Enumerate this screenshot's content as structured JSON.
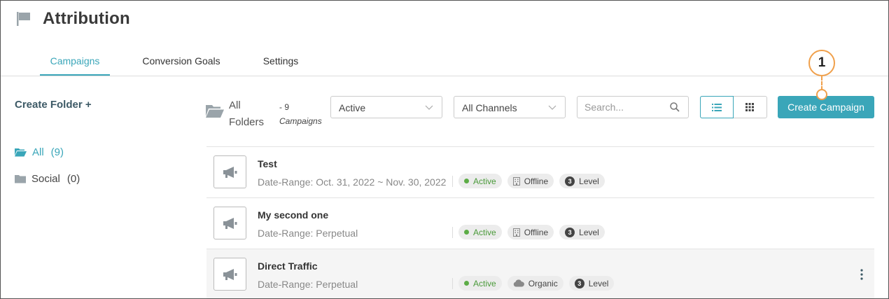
{
  "header": {
    "title": "Attribution",
    "icon": "flag-icon"
  },
  "tabs": [
    {
      "label": "Campaigns",
      "active": true
    },
    {
      "label": "Conversion Goals",
      "active": false
    },
    {
      "label": "Settings",
      "active": false
    }
  ],
  "sidebar": {
    "create_folder": "Create Folder +",
    "folders": [
      {
        "name": "All",
        "count": "(9)",
        "active": true
      },
      {
        "name": "Social",
        "count": "(0)",
        "active": false
      }
    ]
  },
  "toolbar": {
    "folder_label": "All Folders",
    "count_text": "- 9",
    "count_label": "Campaigns",
    "status_select": "Active",
    "channel_select": "All Channels",
    "search_placeholder": "Search...",
    "view_mode": "list",
    "create_button": "Create Campaign"
  },
  "callout": {
    "number": "1"
  },
  "campaigns": [
    {
      "name": "Test",
      "date": "Date-Range: Oct. 31, 2022 ~ Nov. 30, 2022",
      "status": "Active",
      "channel": "Offline",
      "channel_icon": "building-icon",
      "level_num": "3",
      "level_label": "Level"
    },
    {
      "name": "My second one",
      "date": "Date-Range: Perpetual",
      "status": "Active",
      "channel": "Offline",
      "channel_icon": "building-icon",
      "level_num": "3",
      "level_label": "Level"
    },
    {
      "name": "Direct Traffic",
      "date": "Date-Range: Perpetual",
      "status": "Active",
      "channel": "Organic",
      "channel_icon": "cloud-icon",
      "level_num": "3",
      "level_label": "Level"
    }
  ],
  "colors": {
    "accent": "#3aa6b9",
    "callout": "#f0a04b",
    "active_green": "#5cac46"
  }
}
